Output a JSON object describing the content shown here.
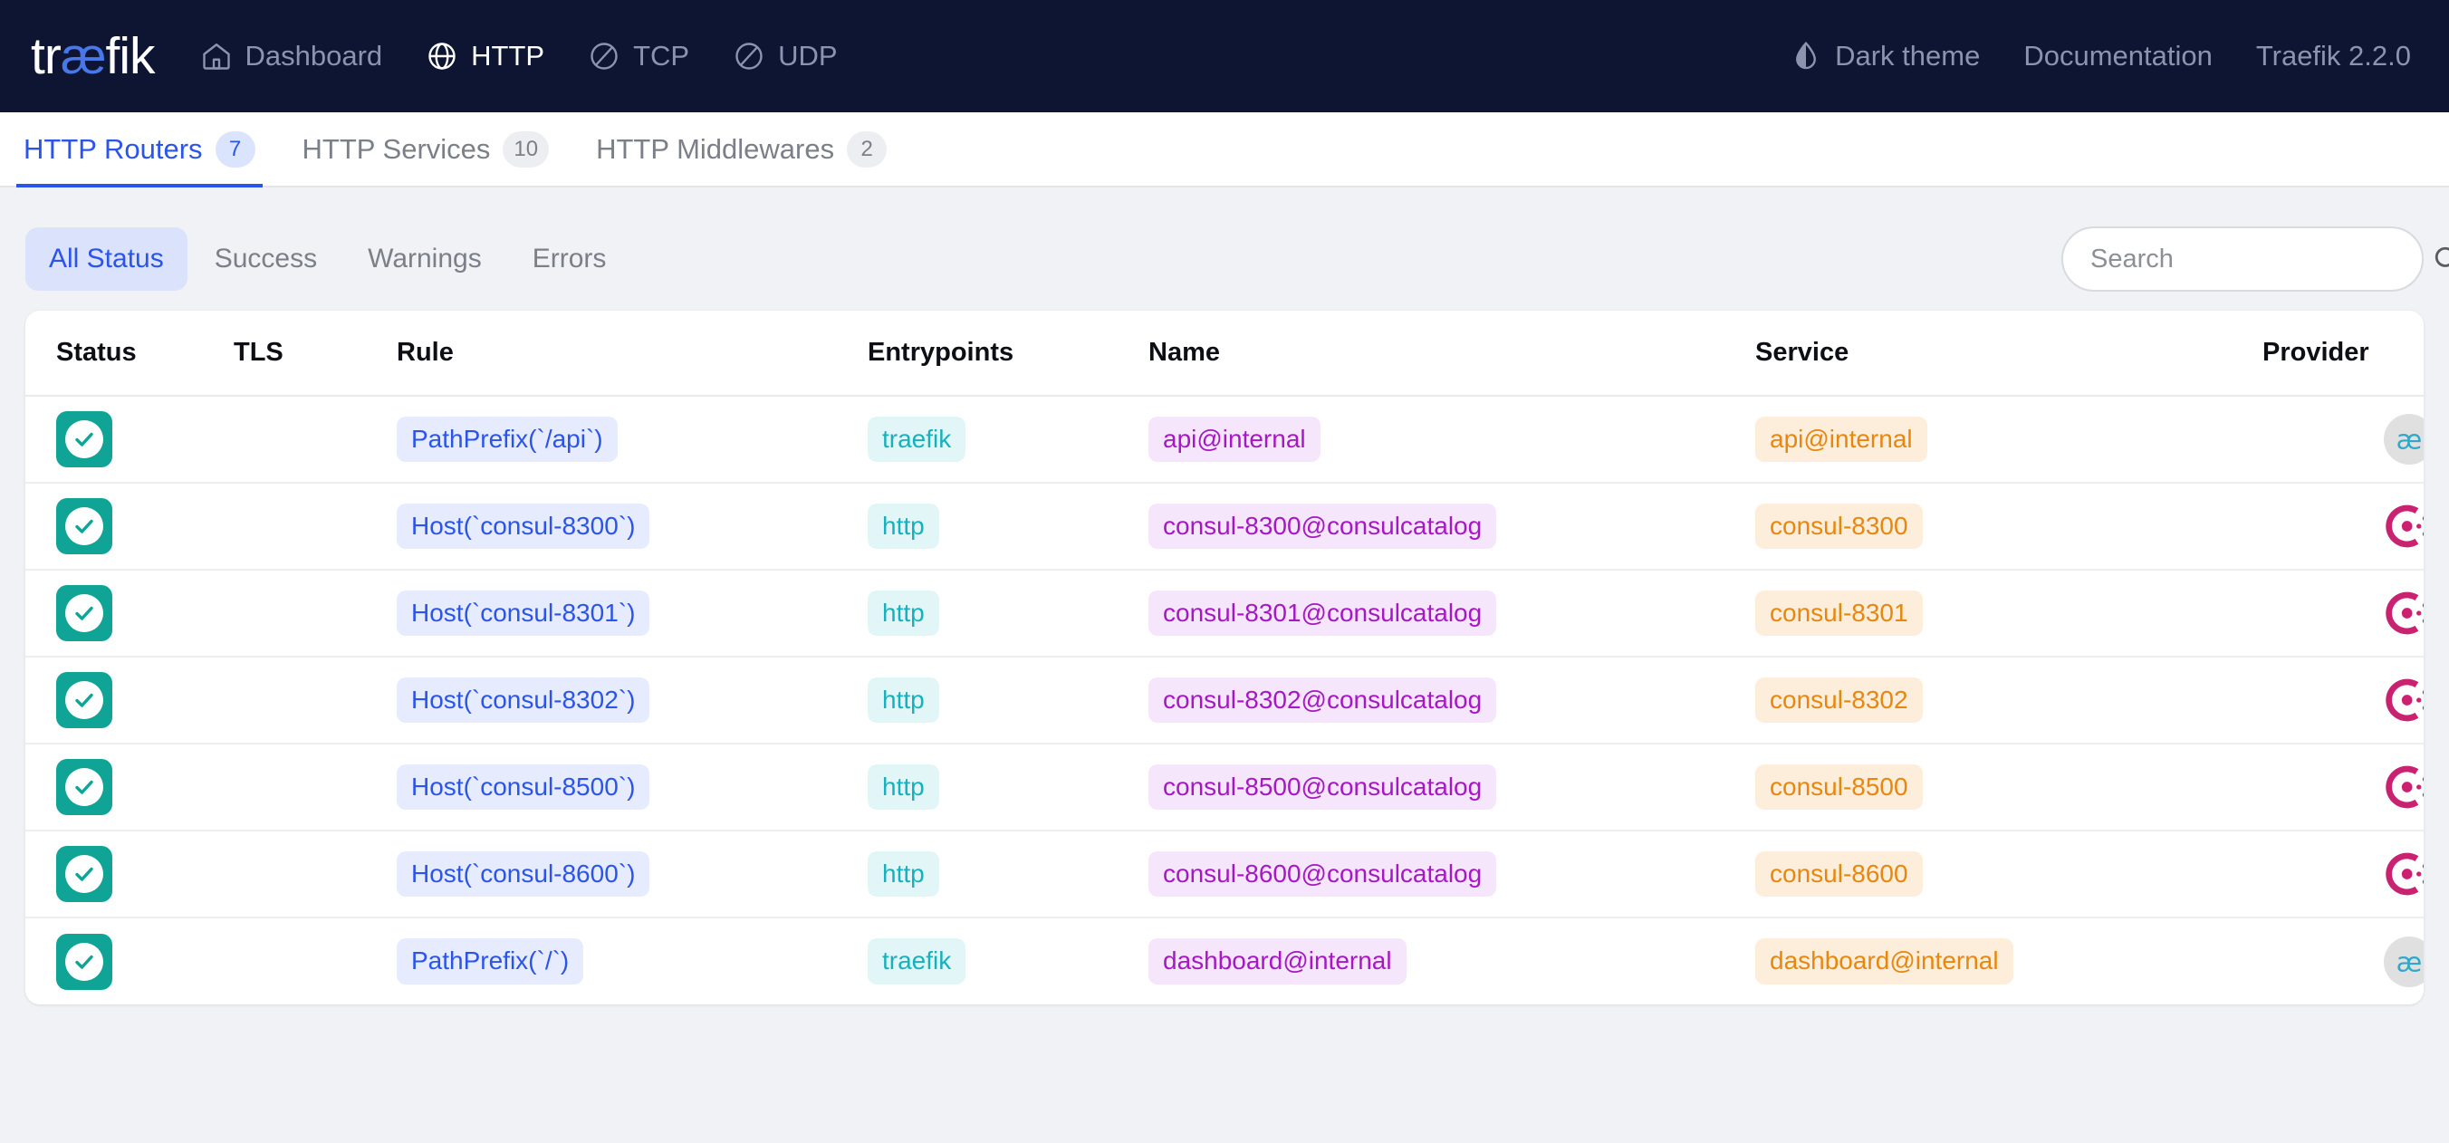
{
  "header": {
    "logo_text": "traefik",
    "logo_pre": "tr",
    "logo_ae": "æ",
    "logo_post": "fik",
    "nav": [
      {
        "label": "Dashboard",
        "icon": "home-icon",
        "active": false
      },
      {
        "label": "HTTP",
        "icon": "globe-icon",
        "active": true
      },
      {
        "label": "TCP",
        "icon": "tcp-icon",
        "active": false
      },
      {
        "label": "UDP",
        "icon": "udp-icon",
        "active": false
      }
    ],
    "right": [
      {
        "label": "Dark theme",
        "icon": "theme-drop-icon"
      },
      {
        "label": "Documentation",
        "icon": ""
      },
      {
        "label": "Traefik 2.2.0",
        "icon": ""
      }
    ],
    "bg_color": "#0d1533",
    "accent_color": "#4877e8"
  },
  "tabs": [
    {
      "label": "HTTP Routers",
      "count": "7",
      "active": true
    },
    {
      "label": "HTTP Services",
      "count": "10",
      "active": false
    },
    {
      "label": "HTTP Middlewares",
      "count": "2",
      "active": false
    }
  ],
  "toolbar": {
    "filters": [
      {
        "label": "All Status",
        "active": true
      },
      {
        "label": "Success",
        "active": false
      },
      {
        "label": "Warnings",
        "active": false
      },
      {
        "label": "Errors",
        "active": false
      }
    ],
    "search": {
      "value": "",
      "placeholder": "Search",
      "icon": "search-icon"
    }
  },
  "table": {
    "columns": [
      "Status",
      "TLS",
      "Rule",
      "Entrypoints",
      "Name",
      "Service",
      "Provider"
    ],
    "rows": [
      {
        "status": "success",
        "tls": "",
        "rule": "PathPrefix(`/api`)",
        "entrypoint": "traefik",
        "name": "api@internal",
        "service": "api@internal",
        "provider": "internal"
      },
      {
        "status": "success",
        "tls": "",
        "rule": "Host(`consul-8300`)",
        "entrypoint": "http",
        "name": "consul-8300@consulcatalog",
        "service": "consul-8300",
        "provider": "consul"
      },
      {
        "status": "success",
        "tls": "",
        "rule": "Host(`consul-8301`)",
        "entrypoint": "http",
        "name": "consul-8301@consulcatalog",
        "service": "consul-8301",
        "provider": "consul"
      },
      {
        "status": "success",
        "tls": "",
        "rule": "Host(`consul-8302`)",
        "entrypoint": "http",
        "name": "consul-8302@consulcatalog",
        "service": "consul-8302",
        "provider": "consul"
      },
      {
        "status": "success",
        "tls": "",
        "rule": "Host(`consul-8500`)",
        "entrypoint": "http",
        "name": "consul-8500@consulcatalog",
        "service": "consul-8500",
        "provider": "consul"
      },
      {
        "status": "success",
        "tls": "",
        "rule": "Host(`consul-8600`)",
        "entrypoint": "http",
        "name": "consul-8600@consulcatalog",
        "service": "consul-8600",
        "provider": "consul"
      },
      {
        "status": "success",
        "tls": "",
        "rule": "PathPrefix(`/`)",
        "entrypoint": "traefik",
        "name": "dashboard@internal",
        "service": "dashboard@internal",
        "provider": "internal"
      }
    ]
  },
  "colors": {
    "status_success": "#10a497",
    "badge_rule": "#2b54eb",
    "badge_entry": "#17b1bd",
    "badge_name": "#a618c4",
    "badge_service": "#e8870f",
    "provider_consul": "#ca2171",
    "provider_internal": "#30a8c8"
  }
}
